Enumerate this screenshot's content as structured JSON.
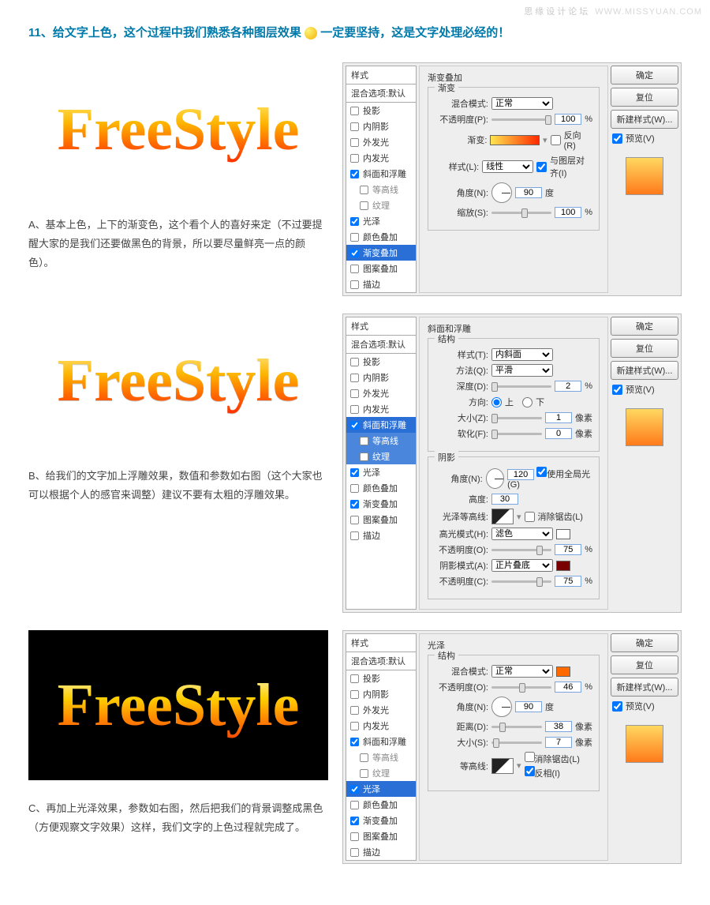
{
  "watermark": {
    "cn": "思缘设计论坛",
    "en": "WWW.MISSYUAN.COM"
  },
  "title": {
    "num": "11、",
    "part1": "给文字上色，这个过程中我们熟悉各种图层效果 ",
    "part2": " 一定要坚持，这是文字处理必经的！"
  },
  "logo_text": "FreeStyle",
  "captions": {
    "a": "A、基本上色，上下的渐变色，这个看个人的喜好来定（不过要提醒大家的是我们还要做黑色的背景，所以要尽量鲜亮一点的颜色）。",
    "b": "B、给我们的文字加上浮雕效果，数值和参数如右图（这个大家也可以根据个人的感官来调整）建议不要有太粗的浮雕效果。",
    "c": "C、再加上光泽效果，参数如右图，然后把我们的背景调整成黑色（方便观察文字效果）这样，我们文字的上色过程就完成了。"
  },
  "style_panel": {
    "header": "样式",
    "blend": "混合选项:默认",
    "items": [
      "投影",
      "内阴影",
      "外发光",
      "内发光",
      "斜面和浮雕",
      "等高线",
      "纹理",
      "光泽",
      "颜色叠加",
      "渐变叠加",
      "图案叠加",
      "描边"
    ]
  },
  "buttons": {
    "ok": "确定",
    "cancel": "复位",
    "new": "新建样式(W)...",
    "preview": "预览(V)"
  },
  "dialogA": {
    "title": "渐变叠加",
    "group": "渐变",
    "blend_label": "混合模式:",
    "blend_value": "正常",
    "opacity_label": "不透明度(P):",
    "opacity": "100",
    "pct": "%",
    "gradient_label": "渐变:",
    "reverse": "反向(R)",
    "style_label": "样式(L):",
    "style_value": "线性",
    "align": "与图层对齐(I)",
    "angle_label": "角度(N):",
    "angle": "90",
    "deg": "度",
    "scale_label": "缩放(S):",
    "scale": "100"
  },
  "dialogB": {
    "title": "斜面和浮雕",
    "group1": "结构",
    "style_label": "样式(T):",
    "style_value": "内斜面",
    "tech_label": "方法(Q):",
    "tech_value": "平滑",
    "depth_label": "深度(D):",
    "depth": "2",
    "pct": "%",
    "dir_label": "方向:",
    "up": "上",
    "down": "下",
    "size_label": "大小(Z):",
    "size": "1",
    "px": "像素",
    "soft_label": "软化(F):",
    "soft": "0",
    "group2": "阴影",
    "angle_label": "角度(N):",
    "angle": "120",
    "use_global": "使用全局光(G)",
    "alt_label": "高度:",
    "alt": "30",
    "gloss_label": "光泽等高线:",
    "antialias": "消除锯齿(L)",
    "hi_mode_label": "高光模式(H):",
    "hi_mode": "滤色",
    "hi_op_label": "不透明度(O):",
    "hi_op": "75",
    "sh_mode_label": "阴影模式(A):",
    "sh_mode": "正片叠底",
    "sh_op_label": "不透明度(C):",
    "sh_op": "75"
  },
  "dialogC": {
    "title": "光泽",
    "group": "结构",
    "blend_label": "混合模式:",
    "blend_value": "正常",
    "opacity_label": "不透明度(O):",
    "opacity": "46",
    "pct": "%",
    "angle_label": "角度(N):",
    "angle": "90",
    "deg": "度",
    "dist_label": "距离(D):",
    "dist": "38",
    "px": "像素",
    "size_label": "大小(S):",
    "size": "7",
    "contour_label": "等高线:",
    "antialias": "消除锯齿(L)",
    "invert": "反相(I)"
  }
}
